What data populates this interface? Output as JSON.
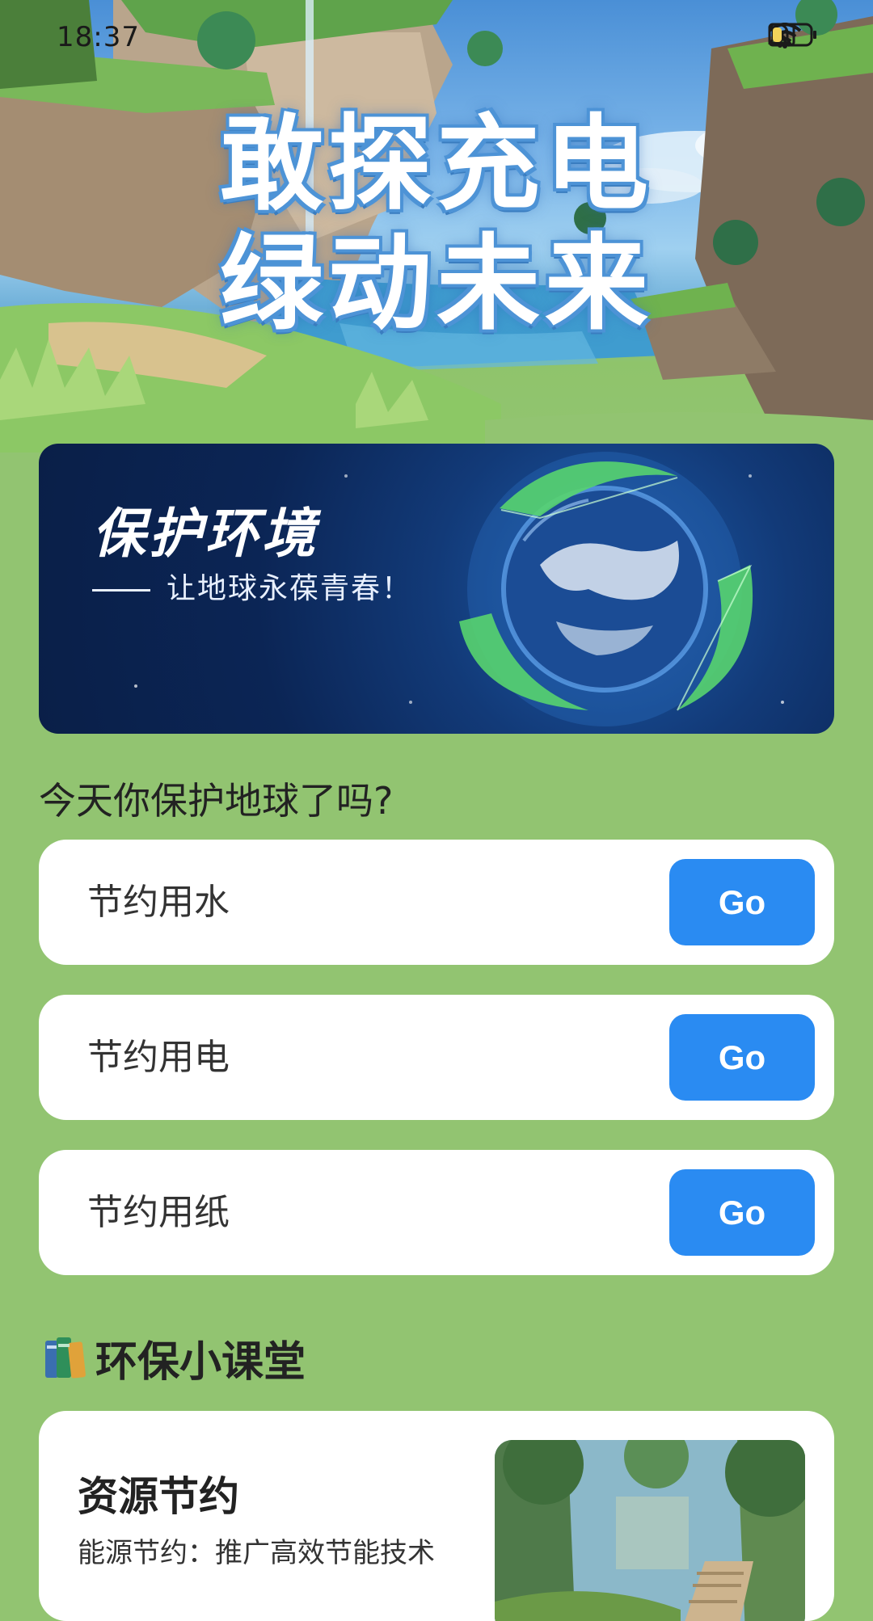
{
  "status_bar": {
    "time": "18:37",
    "icons": [
      "bell-muted-icon",
      "wifi-icon",
      "no-sim-icon",
      "battery-icon"
    ],
    "battery_level": 0.25
  },
  "hero": {
    "title_line1": "敢探充电",
    "title_line2": "绿动未来"
  },
  "banner": {
    "title": "保护环境",
    "subtitle": "让地球永葆青春！"
  },
  "question": "今天你保护地球了吗?",
  "actions": [
    {
      "label": "节约用水",
      "button": "Go"
    },
    {
      "label": "节约用电",
      "button": "Go"
    },
    {
      "label": "节约用纸",
      "button": "Go"
    }
  ],
  "section": {
    "icon": "books-icon",
    "title": "环保小课堂"
  },
  "lesson": {
    "title": "资源节约",
    "description": "能源节约：推广高效节能技术"
  },
  "colors": {
    "background": "#92c471",
    "button": "#2a8bf2",
    "title_outline": "#4d93d6"
  }
}
